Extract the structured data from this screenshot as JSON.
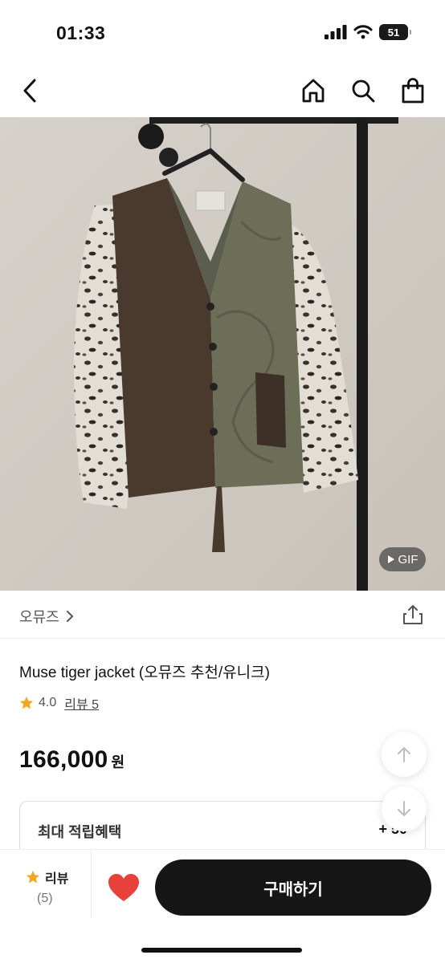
{
  "status_bar": {
    "time": "01:33",
    "battery": "51"
  },
  "nav": {
    "back_icon": "chevron-left-icon",
    "home_icon": "home-icon",
    "search_icon": "search-icon",
    "cart_icon": "shopping-bag-icon"
  },
  "image": {
    "gif_label": "GIF"
  },
  "brand": {
    "name": "오뮤즈"
  },
  "product": {
    "title": "Muse tiger jacket (오뮤즈 추천/유니크)",
    "rating": "4.0",
    "review_link": "리뷰 5",
    "price": "166,000",
    "price_unit": "원"
  },
  "benefit": {
    "label": "최대 적립혜택",
    "value": "+ 50"
  },
  "bottom_bar": {
    "review_label": "리뷰",
    "review_count": "(5)",
    "buy_label": "구매하기"
  },
  "colors": {
    "accent_star": "#f5a623",
    "heart": "#e8413a",
    "buy_button": "#161616"
  }
}
